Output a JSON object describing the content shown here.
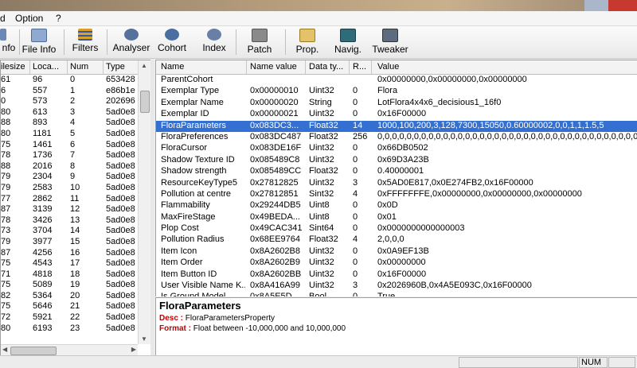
{
  "menu": {
    "items": [
      "d",
      "Option",
      "?"
    ]
  },
  "toolbar": {
    "buttons": [
      {
        "label": "nfo",
        "icon": "info-icon"
      },
      {
        "label": "File Info",
        "icon": "file-info-icon"
      },
      {
        "label": "Filters",
        "icon": "filters-icon"
      },
      {
        "label": "Analyser",
        "icon": "analyser-icon"
      },
      {
        "label": "Cohort",
        "icon": "cohort-icon"
      },
      {
        "label": "Index",
        "icon": "index-icon"
      },
      {
        "label": "Patch",
        "icon": "patch-icon"
      },
      {
        "label": "Prop.",
        "icon": "properties-icon"
      },
      {
        "label": "Navig.",
        "icon": "navigator-icon"
      },
      {
        "label": "Tweaker",
        "icon": "tweaker-icon"
      }
    ]
  },
  "left_table": {
    "columns": [
      "ilesize",
      "Loca...",
      "Num",
      "Type"
    ],
    "rows": [
      [
        "61",
        "96",
        "0",
        "653428"
      ],
      [
        "6",
        "557",
        "1",
        "e86b1e"
      ],
      [
        "0",
        "573",
        "2",
        "202696"
      ],
      [
        "80",
        "613",
        "3",
        "5ad0e8"
      ],
      [
        "88",
        "893",
        "4",
        "5ad0e8"
      ],
      [
        "80",
        "1181",
        "5",
        "5ad0e8"
      ],
      [
        "75",
        "1461",
        "6",
        "5ad0e8"
      ],
      [
        "78",
        "1736",
        "7",
        "5ad0e8"
      ],
      [
        "88",
        "2016",
        "8",
        "5ad0e8"
      ],
      [
        "79",
        "2304",
        "9",
        "5ad0e8"
      ],
      [
        "79",
        "2583",
        "10",
        "5ad0e8"
      ],
      [
        "77",
        "2862",
        "11",
        "5ad0e8"
      ],
      [
        "87",
        "3139",
        "12",
        "5ad0e8"
      ],
      [
        "78",
        "3426",
        "13",
        "5ad0e8"
      ],
      [
        "73",
        "3704",
        "14",
        "5ad0e8"
      ],
      [
        "79",
        "3977",
        "15",
        "5ad0e8"
      ],
      [
        "87",
        "4256",
        "16",
        "5ad0e8"
      ],
      [
        "75",
        "4543",
        "17",
        "5ad0e8"
      ],
      [
        "71",
        "4818",
        "18",
        "5ad0e8"
      ],
      [
        "75",
        "5089",
        "19",
        "5ad0e8"
      ],
      [
        "82",
        "5364",
        "20",
        "5ad0e8"
      ],
      [
        "75",
        "5646",
        "21",
        "5ad0e8"
      ],
      [
        "72",
        "5921",
        "22",
        "5ad0e8"
      ],
      [
        "80",
        "6193",
        "23",
        "5ad0e8"
      ]
    ]
  },
  "right_table": {
    "columns": [
      "Name",
      "Name value",
      "Data ty...",
      "R...",
      "Value"
    ],
    "selected_index": 4,
    "rows": [
      [
        "ParentCohort",
        "",
        "",
        "",
        "0x00000000,0x00000000,0x00000000"
      ],
      [
        "Exemplar Type",
        "0x00000010",
        "Uint32",
        "0",
        "Flora"
      ],
      [
        "Exemplar Name",
        "0x00000020",
        "String",
        "0",
        "LotFlora4x4x6_decisious1_16f0"
      ],
      [
        "Exemplar ID",
        "0x00000021",
        "Uint32",
        "0",
        "0x16F00000"
      ],
      [
        "FloraParameters",
        "0x083DC3...",
        "Float32",
        "14",
        "1000,100,200,3,128,7300,15050,0.60000002,0,0,1,1,1.5,5"
      ],
      [
        "FloraPreferences",
        "0x083DC487",
        "Float32",
        "256",
        "0,0,0,0,0,0,0,0,0,0,0,0,0,0,0,0,0,0,0,0,0,0,0,0,0,0,0,0,0,0,0,0,0,0,0,0,0,0,..."
      ],
      [
        "FloraCursor",
        "0x083DE16F",
        "Uint32",
        "0",
        "0x66DB0502"
      ],
      [
        "Shadow Texture ID",
        "0x085489C8",
        "Uint32",
        "0",
        "0x69D3A23B"
      ],
      [
        "Shadow strength",
        "0x085489CC",
        "Float32",
        "0",
        "0.40000001"
      ],
      [
        "ResourceKeyType5",
        "0x27812825",
        "Uint32",
        "3",
        "0x5AD0E817,0x0E274FB2,0x16F00000"
      ],
      [
        "Pollution at centre",
        "0x27812851",
        "Sint32",
        "4",
        "0xFFFFFFFE,0x00000000,0x00000000,0x00000000"
      ],
      [
        "Flammability",
        "0x29244DB5",
        "Uint8",
        "0",
        "0x0D"
      ],
      [
        "MaxFireStage",
        "0x49BEDA...",
        "Uint8",
        "0",
        "0x01"
      ],
      [
        "Plop Cost",
        "0x49CAC341",
        "Sint64",
        "0",
        "0x0000000000000003"
      ],
      [
        "Pollution Radius",
        "0x68EE9764",
        "Float32",
        "4",
        "2,0,0,0"
      ],
      [
        "Item Icon",
        "0x8A2602B8",
        "Uint32",
        "0",
        "0x0A9EF13B"
      ],
      [
        "Item Order",
        "0x8A2602B9",
        "Uint32",
        "0",
        "0x00000000"
      ],
      [
        "Item Button ID",
        "0x8A2602BB",
        "Uint32",
        "0",
        "0x16F00000"
      ],
      [
        "User Visible Name K...",
        "0x8A416A99",
        "Uint32",
        "3",
        "0x2026960B,0x4A5E093C,0x16F00000"
      ],
      [
        "Is Ground Model",
        "0x8A5E5D...",
        "Bool",
        "0",
        "True"
      ]
    ]
  },
  "description": {
    "title": "FloraParameters",
    "desc_key": "Desc :",
    "desc_value": "FloraParametersProperty",
    "format_key": "Format :",
    "format_value": "Float between -10,000,000 and 10,000,000"
  },
  "statusbar": {
    "num": "NUM"
  },
  "colors": {
    "selection": "#3470d2",
    "desc_key": "#c00000"
  }
}
